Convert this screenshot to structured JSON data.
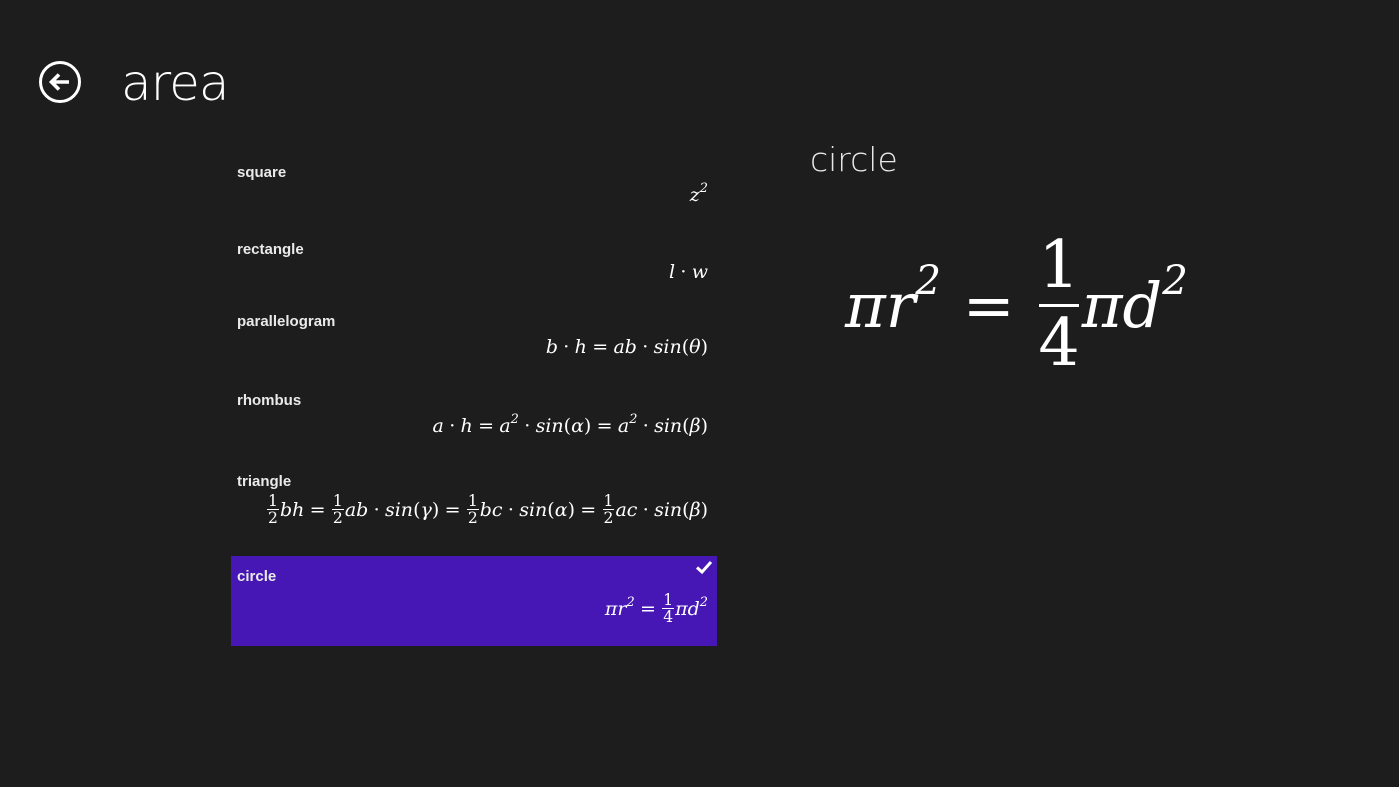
{
  "header": {
    "title": "area",
    "back_icon": "back-arrow-circle-icon"
  },
  "list": {
    "items": [
      {
        "label": "square",
        "formula": "z²",
        "selected": false
      },
      {
        "label": "rectangle",
        "formula": "l · w",
        "selected": false
      },
      {
        "label": "parallelogram",
        "formula": "b · h = ab · sin(θ)",
        "selected": false
      },
      {
        "label": "rhombus",
        "formula": "a · h = a² · sin(α) = a² · sin(β)",
        "selected": false
      },
      {
        "label": "triangle",
        "formula": "½bh = ½ab · sin(γ) = ½bc · sin(α) = ½ac · sin(β)",
        "selected": false
      },
      {
        "label": "circle",
        "formula": "πr² = ¼πd²",
        "selected": true
      }
    ],
    "selected_color": "#4617b4",
    "check_icon": "checkmark-icon"
  },
  "detail": {
    "title": "circle",
    "formula": "πr² = ¼πd²"
  }
}
